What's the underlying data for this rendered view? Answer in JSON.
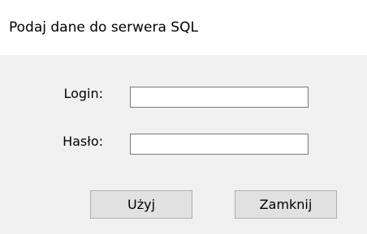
{
  "window": {
    "title": "Podaj dane do serwera SQL"
  },
  "form": {
    "login_label": "Login:",
    "login_value": "",
    "password_label": "Hasło:",
    "password_value": ""
  },
  "buttons": {
    "use_label": "Użyj",
    "close_label": "Zamknij"
  }
}
